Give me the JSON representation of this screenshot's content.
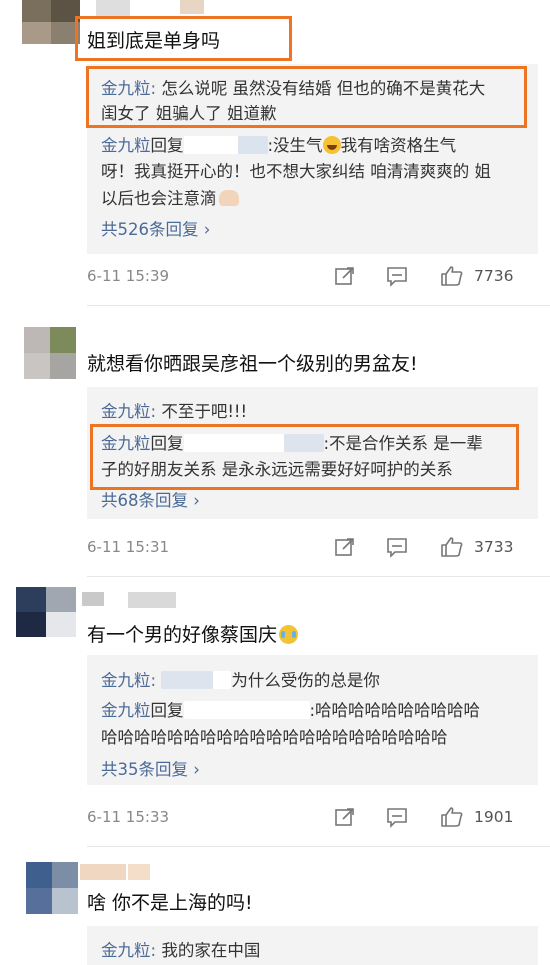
{
  "comments": [
    {
      "text": "姐到底是单身吗",
      "replies": [
        {
          "user": "金九粒",
          "text": "怎么说呢 虽然没有结婚 但也的确不是黄花大",
          "text2": "闺女了 姐骗人了 姐道歉"
        },
        {
          "user": "金九粒",
          "action": "回复",
          "text": ":没生气",
          "text_b": "我有啥资格生气",
          "text2": "呀！我真挺开心的！也不想大家纠结 咱清清爽爽的 姐",
          "text3": "以后也会注意滴"
        }
      ],
      "more": "共526条回复",
      "date": "6-11 15:39",
      "likes": "7736"
    },
    {
      "text": "就想看你晒跟吴彦祖一个级别的男盆友!",
      "replies": [
        {
          "user": "金九粒",
          "text": "不至于吧!!!"
        },
        {
          "user": "金九粒",
          "action": "回复",
          "text": ":不是合作关系 是一辈",
          "text2": "子的好朋友关系 是永永远远需要好好呵护的关系"
        }
      ],
      "more": "共68条回复",
      "date": "6-11 15:31",
      "likes": "3733"
    },
    {
      "text": "有一个男的好像蔡国庆",
      "replies": [
        {
          "user": "金九粒",
          "text": "为什么受伤的总是你"
        },
        {
          "user": "金九粒",
          "action": "回复",
          "text": ":哈哈哈哈哈哈哈哈哈哈",
          "text2": "哈哈哈哈哈哈哈哈哈哈哈哈哈哈哈哈哈哈哈哈哈"
        }
      ],
      "more": "共35条回复",
      "date": "6-11 15:33",
      "likes": "1901"
    },
    {
      "text": "啥 你不是上海的吗!",
      "replies": [
        {
          "user": "金九粒",
          "text": "我的家在中国"
        }
      ]
    }
  ],
  "colors": {
    "highlight": "#ec7423",
    "username": "#4b6b97",
    "reply_bg": "#f3f3f3"
  },
  "icons": [
    "share-icon",
    "comment-icon",
    "like-icon",
    "chevron-right-icon",
    "laugh-emoji-icon",
    "flex-arm-emoji-icon",
    "cry-laugh-emoji-icon"
  ]
}
